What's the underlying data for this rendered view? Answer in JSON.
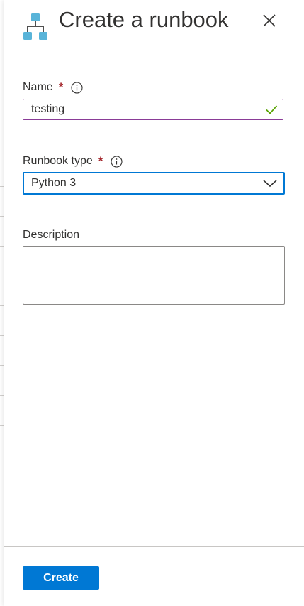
{
  "panel": {
    "title": "Create a runbook",
    "icon": "runbook-hierarchy-icon",
    "close_icon": "close-icon"
  },
  "form": {
    "name": {
      "label": "Name",
      "required_mark": "*",
      "value": "testing",
      "valid": true
    },
    "runbook_type": {
      "label": "Runbook type",
      "required_mark": "*",
      "selected": "Python 3"
    },
    "description": {
      "label": "Description",
      "value": ""
    }
  },
  "footer": {
    "create_label": "Create"
  },
  "colors": {
    "accent": "#0078d4",
    "required": "#a4262c",
    "valid": "#57a300",
    "input_border": "#8a3b97",
    "icon_blue": "#59b4d9"
  }
}
